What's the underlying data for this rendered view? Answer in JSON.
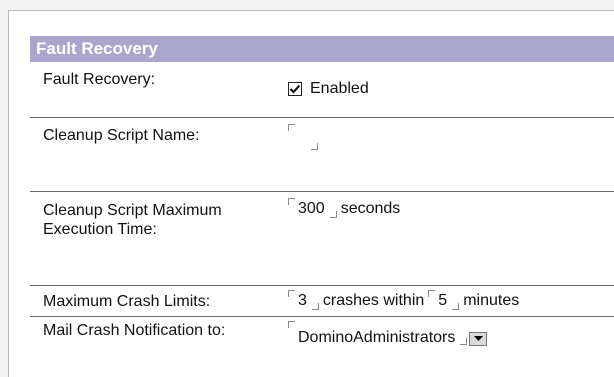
{
  "section": {
    "title": "Fault Recovery"
  },
  "rows": {
    "fault_recovery": {
      "label": "Fault Recovery:",
      "checkbox_label": "Enabled",
      "checked": true
    },
    "cleanup_script": {
      "label": "Cleanup Script Name:",
      "value": ""
    },
    "max_exec_time": {
      "label": "Cleanup Script Maximum Execution Time:",
      "value": "300",
      "unit": "seconds"
    },
    "crash_limits": {
      "label": "Maximum Crash Limits:",
      "crashes": "3",
      "crashes_unit": "crashes within",
      "minutes": "5",
      "minutes_unit": "minutes"
    },
    "mail_notification": {
      "label": "Mail Crash Notification to:",
      "value": "DominoAdministrators"
    }
  },
  "icons": {
    "checkbox_check": "check-icon",
    "dropdown": "dropdown-arrow-icon"
  }
}
